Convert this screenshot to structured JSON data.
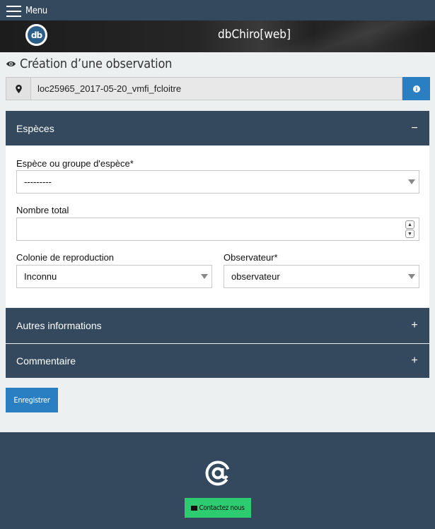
{
  "topbar": {
    "menu_label": "Menu"
  },
  "banner": {
    "brand": "dbChiro[web]",
    "logo_text": "db"
  },
  "page": {
    "title": "Création d’une observation"
  },
  "location": {
    "value": "loc25965_2017-05-20_vmfi_fcloitre"
  },
  "panels": {
    "especes": {
      "title": "Espèces",
      "toggle": "−"
    },
    "autres": {
      "title": "Autres informations",
      "toggle": "+"
    },
    "commentaire": {
      "title": "Commentaire",
      "toggle": "+"
    }
  },
  "form": {
    "espece_label": "Espèce ou groupe d'espèce*",
    "espece_value": "---------",
    "nombre_label": "Nombre total",
    "nombre_value": "",
    "colonie_label": "Colonie de reproduction",
    "colonie_value": "Inconnu",
    "observateur_label": "Observateur*",
    "observateur_value": "observateur"
  },
  "actions": {
    "save_label": "Enregistrer"
  },
  "footer": {
    "contact_label": "Contactez nous"
  },
  "colors": {
    "navy": "#34495e",
    "primary": "#2a7ec2",
    "success": "#2ecc71",
    "background": "#ecf0f1"
  }
}
